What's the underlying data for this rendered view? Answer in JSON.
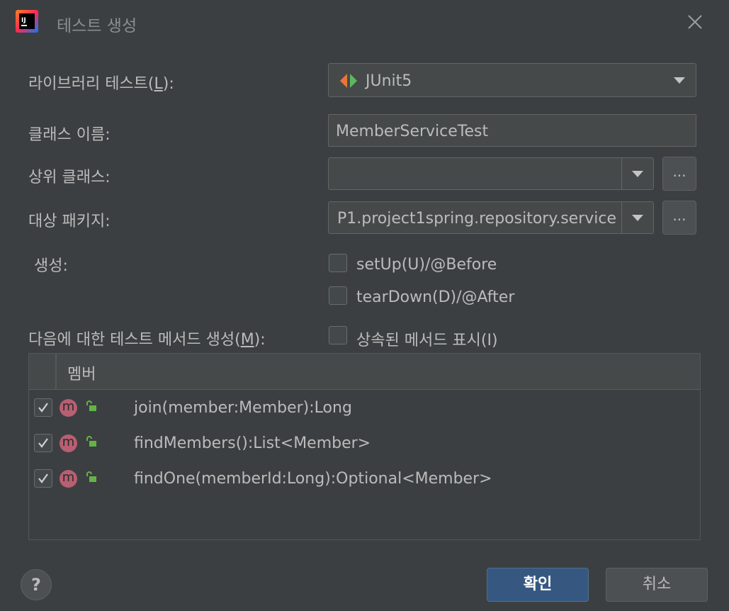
{
  "window": {
    "title": "테스트 생성",
    "logo_text": "IJ"
  },
  "form": {
    "library": {
      "label": "라이브러리 테스트(L):",
      "label_prefix": "라이브러리 테스트(",
      "label_mnemonic": "L",
      "label_suffix": "):",
      "value": "JUnit5"
    },
    "class_name": {
      "label": "클래스 이름:",
      "value": "MemberServiceTest"
    },
    "superclass": {
      "label": "상위 클래스:",
      "value": "",
      "browse": "..."
    },
    "package": {
      "label": "대상 패키지:",
      "value": "P1.project1spring.repository.service",
      "browse": "..."
    },
    "generate": {
      "label": "생성:",
      "options": [
        {
          "label": "setUp(U)/@Before",
          "checked": false
        },
        {
          "label": "tearDown(D)/@After",
          "checked": false
        }
      ]
    },
    "methods": {
      "label": "다음에 대한 테스트 메서드 생성(M):",
      "label_prefix": "다음에 대한 테스트 메서드 생성(",
      "label_mnemonic": "M",
      "label_suffix": "):",
      "show_inherited": {
        "label": "상속된 메서드 표시(I)",
        "checked": false
      }
    }
  },
  "table": {
    "header": "멤버",
    "rows": [
      {
        "checked": true,
        "icon": "method-icon",
        "icon_letter": "m",
        "text": "join(member:Member):Long"
      },
      {
        "checked": true,
        "icon": "method-icon",
        "icon_letter": "m",
        "text": "findMembers():List<Member>"
      },
      {
        "checked": true,
        "icon": "method-icon",
        "icon_letter": "m",
        "text": "findOne(memberId:Long):Optional<Member>"
      }
    ]
  },
  "buttons": {
    "help": "?",
    "ok": "확인",
    "cancel": "취소"
  },
  "colors": {
    "background": "#3c3f41",
    "field": "#45494a",
    "primary_button": "#365880",
    "method_icon": "#b85f72",
    "lock_icon": "#62b543"
  }
}
